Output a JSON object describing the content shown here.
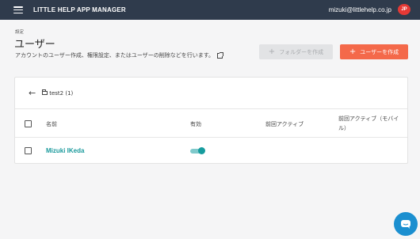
{
  "header": {
    "app_title": "LITTLE HELP APP MANAGER",
    "user_email": "mizuki@littlehelp.co.jp",
    "avatar_text": "JP"
  },
  "page": {
    "breadcrumb": "設定",
    "title": "ユーザー",
    "description": "アカウントのユーザー作成、権限設定、またはユーザーの削除などを行います。"
  },
  "actions": {
    "create_folder_label": "フォルダーを作成",
    "create_user_label": "ユーザーを作成"
  },
  "folder": {
    "label": "test2 (1)"
  },
  "table": {
    "columns": {
      "name": "名前",
      "active": "有効",
      "last_active": "前回アクティブ",
      "last_active_mobile": "前回アクティブ（モバイル）"
    },
    "rows": [
      {
        "name": "Mizuki IKeda",
        "active": true,
        "last_active": "",
        "last_active_mobile": ""
      }
    ]
  },
  "colors": {
    "topbar": "#2f3b4c",
    "accent_orange": "#f4694a",
    "accent_teal": "#1a9a9c",
    "chat": "#1b8fd0"
  }
}
